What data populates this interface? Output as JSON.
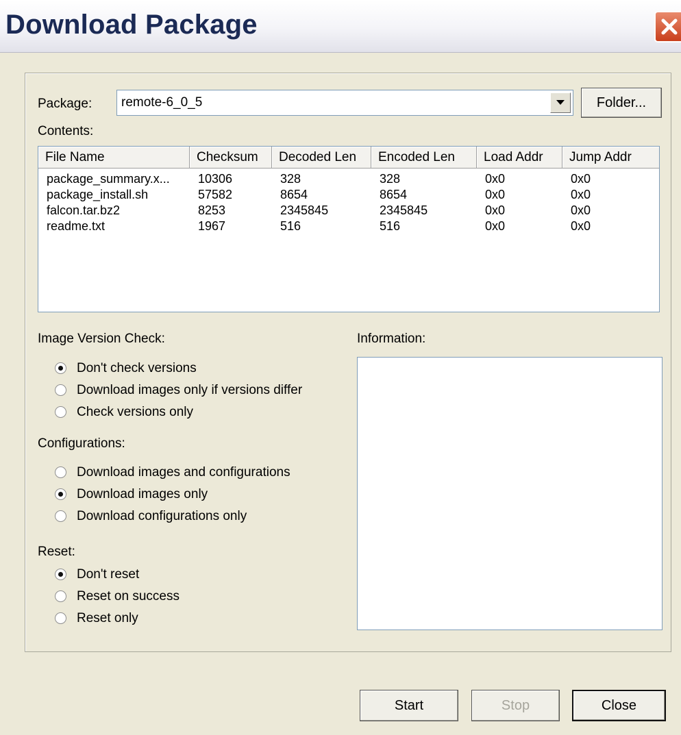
{
  "window": {
    "title": "Download Package"
  },
  "package": {
    "label": "Package:",
    "value": "remote-6_0_5",
    "folder_button": "Folder..."
  },
  "contents": {
    "label": "Contents:",
    "columns": [
      "File Name",
      "Checksum",
      "Decoded Len",
      "Encoded Len",
      "Load Addr",
      "Jump Addr"
    ],
    "rows": [
      [
        "package_summary.x...",
        "10306",
        "328",
        "328",
        "0x0",
        "0x0"
      ],
      [
        "package_install.sh",
        "57582",
        "8654",
        "8654",
        "0x0",
        "0x0"
      ],
      [
        "falcon.tar.bz2",
        "8253",
        "2345845",
        "2345845",
        "0x0",
        "0x0"
      ],
      [
        "readme.txt",
        "1967",
        "516",
        "516",
        "0x0",
        "0x0"
      ]
    ]
  },
  "image_version_check": {
    "label": "Image Version Check:",
    "options": [
      {
        "label": "Don't check versions",
        "checked": true
      },
      {
        "label": "Download images only if versions differ",
        "checked": false
      },
      {
        "label": "Check versions only",
        "checked": false
      }
    ]
  },
  "configurations": {
    "label": "Configurations:",
    "options": [
      {
        "label": "Download images and configurations",
        "checked": false
      },
      {
        "label": "Download images only",
        "checked": true
      },
      {
        "label": "Download configurations only",
        "checked": false
      }
    ]
  },
  "reset": {
    "label": "Reset:",
    "options": [
      {
        "label": "Don't reset",
        "checked": true
      },
      {
        "label": "Reset on success",
        "checked": false
      },
      {
        "label": "Reset only",
        "checked": false
      }
    ]
  },
  "information": {
    "label": "Information:"
  },
  "buttons": {
    "start": "Start",
    "stop": "Stop",
    "close": "Close"
  },
  "icons": {
    "close": "close-x-icon",
    "dropdown": "chevron-down-icon"
  },
  "colors": {
    "title_text": "#1b2a55",
    "close_button": "#c9401d",
    "dialog_bg": "#ece9d8"
  }
}
